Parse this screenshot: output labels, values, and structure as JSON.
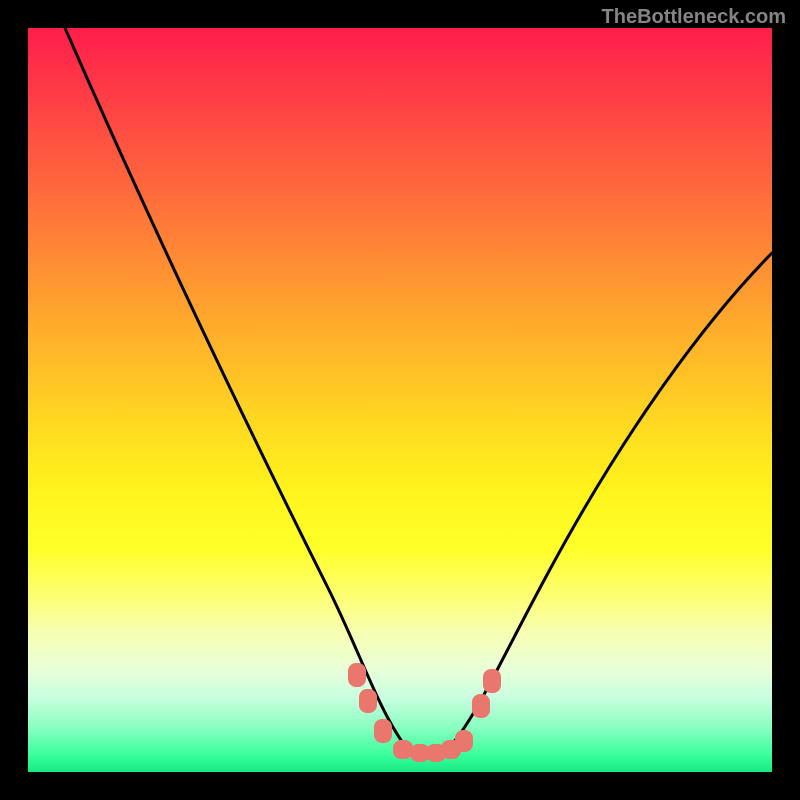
{
  "watermark": "TheBottleneck.com",
  "chart_data": {
    "type": "line",
    "title": "",
    "xlabel": "",
    "ylabel": "",
    "xlim": [
      0,
      100
    ],
    "ylim": [
      0,
      100
    ],
    "series": [
      {
        "name": "curve",
        "x": [
          5,
          10,
          15,
          20,
          25,
          30,
          35,
          40,
          43,
          46,
          49,
          51,
          53,
          55,
          57,
          60,
          65,
          70,
          75,
          80,
          85,
          90,
          95,
          100
        ],
        "y": [
          100,
          90,
          79,
          68,
          57,
          46,
          35,
          24,
          16,
          10,
          5,
          3,
          2.5,
          2.5,
          3,
          5,
          11,
          19,
          28,
          37,
          46,
          54,
          61,
          67
        ]
      }
    ],
    "markers": {
      "name": "highlighted-points",
      "shape": "rounded-rect",
      "color": "#e9776e",
      "points": [
        {
          "x": 44.0,
          "y": 13.5
        },
        {
          "x": 45.5,
          "y": 10.0
        },
        {
          "x": 47.5,
          "y": 6.0
        },
        {
          "x": 50.0,
          "y": 3.2
        },
        {
          "x": 52.0,
          "y": 2.6
        },
        {
          "x": 54.0,
          "y": 2.6
        },
        {
          "x": 56.0,
          "y": 3.0
        },
        {
          "x": 58.0,
          "y": 4.3
        },
        {
          "x": 60.5,
          "y": 9.0
        },
        {
          "x": 62.0,
          "y": 12.0
        }
      ]
    },
    "gradient_stops": [
      {
        "pos": 0.0,
        "color": "#ff1e4b"
      },
      {
        "pos": 0.5,
        "color": "#ffe020"
      },
      {
        "pos": 0.82,
        "color": "#f8ffb0"
      },
      {
        "pos": 1.0,
        "color": "#17e884"
      }
    ]
  }
}
